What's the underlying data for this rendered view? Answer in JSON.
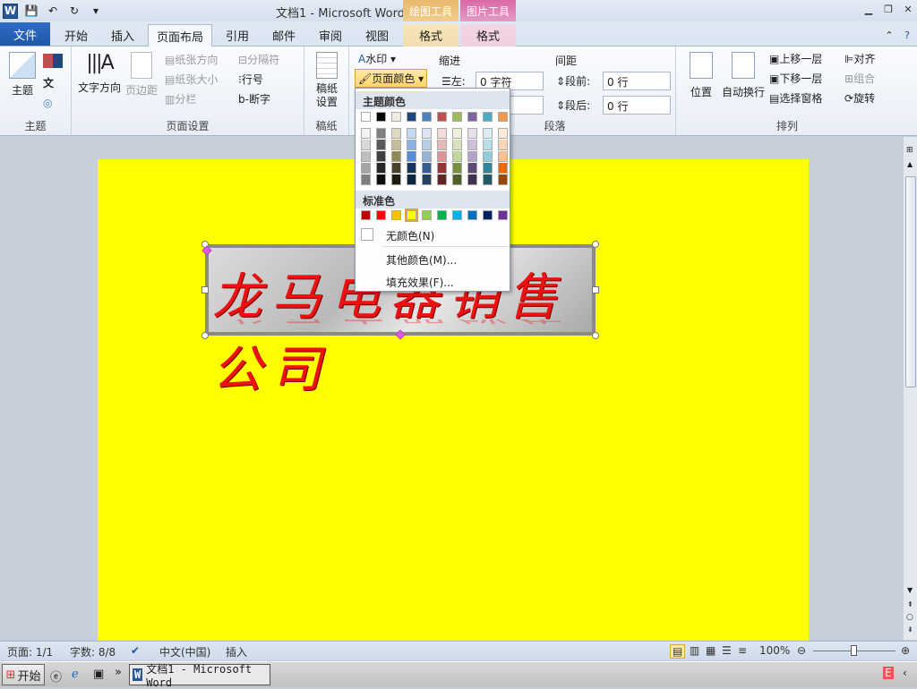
{
  "window": {
    "title": "文档1 - Microsoft Word"
  },
  "context_tabs": {
    "drawing_tools": "绘图工具",
    "picture_tools": "图片工具",
    "format1": "格式",
    "format2": "格式"
  },
  "tabs": [
    "文件",
    "开始",
    "插入",
    "页面布局",
    "引用",
    "邮件",
    "审阅",
    "视图"
  ],
  "ribbon": {
    "themes": {
      "label": "主题",
      "btn": "主题"
    },
    "page_setup": {
      "label": "页面设置",
      "text_dir": "文字方向",
      "margins": "页边距",
      "orientation": "纸张方向",
      "size": "纸张大小",
      "columns": "分栏",
      "breaks": "分隔符",
      "line_numbers": "行号",
      "hyphenation": "断字"
    },
    "paper": {
      "label": "稿纸",
      "btn1": "稿纸",
      "btn2": "设置"
    },
    "bg": {
      "watermark": "水印",
      "page_color": "页面颜色"
    },
    "paragraph": {
      "label": "段落",
      "indent": "缩进",
      "left": "左:",
      "left_value": "0 字符",
      "spacing": "间距",
      "before": "段前:",
      "before_value": "0 行",
      "after": "段后:",
      "after_value": "0 行"
    },
    "arrange": {
      "label": "排列",
      "position": "位置",
      "wrap": "自动换行",
      "bring_forward": "上移一层",
      "send_backward": "下移一层",
      "selection_pane": "选择窗格",
      "align": "对齐",
      "group": "组合",
      "rotate": "旋转"
    }
  },
  "menu": {
    "theme_colors_label": "主题颜色",
    "theme_top": [
      "#ffffff",
      "#000000",
      "#eeece1",
      "#1f497d",
      "#4f81bd",
      "#c0504d",
      "#9bbb59",
      "#8064a2",
      "#4bacc6",
      "#f79646"
    ],
    "theme_cols": [
      [
        "#f2f2f2",
        "#d8d8d8",
        "#bfbfbf",
        "#a5a5a5",
        "#7f7f7f"
      ],
      [
        "#7f7f7f",
        "#595959",
        "#3f3f3f",
        "#262626",
        "#0c0c0c"
      ],
      [
        "#ddd9c3",
        "#c4bd97",
        "#938953",
        "#494429",
        "#1d1b10"
      ],
      [
        "#c6d9f0",
        "#8db3e2",
        "#548dd4",
        "#17365d",
        "#0f243e"
      ],
      [
        "#dbe5f1",
        "#b8cce4",
        "#95b3d7",
        "#366092",
        "#244061"
      ],
      [
        "#f2dcdb",
        "#e5b9b7",
        "#d99694",
        "#953734",
        "#632423"
      ],
      [
        "#ebf1dd",
        "#d7e3bc",
        "#c3d69b",
        "#76923c",
        "#4f6128"
      ],
      [
        "#e5e0ec",
        "#ccc1d9",
        "#b2a2c7",
        "#5f497a",
        "#3f3151"
      ],
      [
        "#dbeef3",
        "#b7dde8",
        "#92cddc",
        "#31859b",
        "#205867"
      ],
      [
        "#fdeada",
        "#fbd5b5",
        "#fac08f",
        "#e36c09",
        "#974806"
      ]
    ],
    "standard_label": "标准色",
    "standard": [
      "#c00000",
      "#ff0000",
      "#ffc000",
      "#ffff00",
      "#92d050",
      "#00b050",
      "#00b0f0",
      "#0070c0",
      "#002060",
      "#7030a0"
    ],
    "no_color": "无颜色(N)",
    "more_colors": "其他颜色(M)...",
    "fill_effects": "填充效果(F)..."
  },
  "document": {
    "wordart_text": "龙马电器销售公司",
    "page_color": "#ffff00"
  },
  "status": {
    "page": "页面: 1/1",
    "words": "字数: 8/8",
    "language": "中文(中国)",
    "mode": "插入",
    "zoom": "100%"
  },
  "taskbar": {
    "start": "开始",
    "item": "文档1 - Microsoft Word"
  }
}
